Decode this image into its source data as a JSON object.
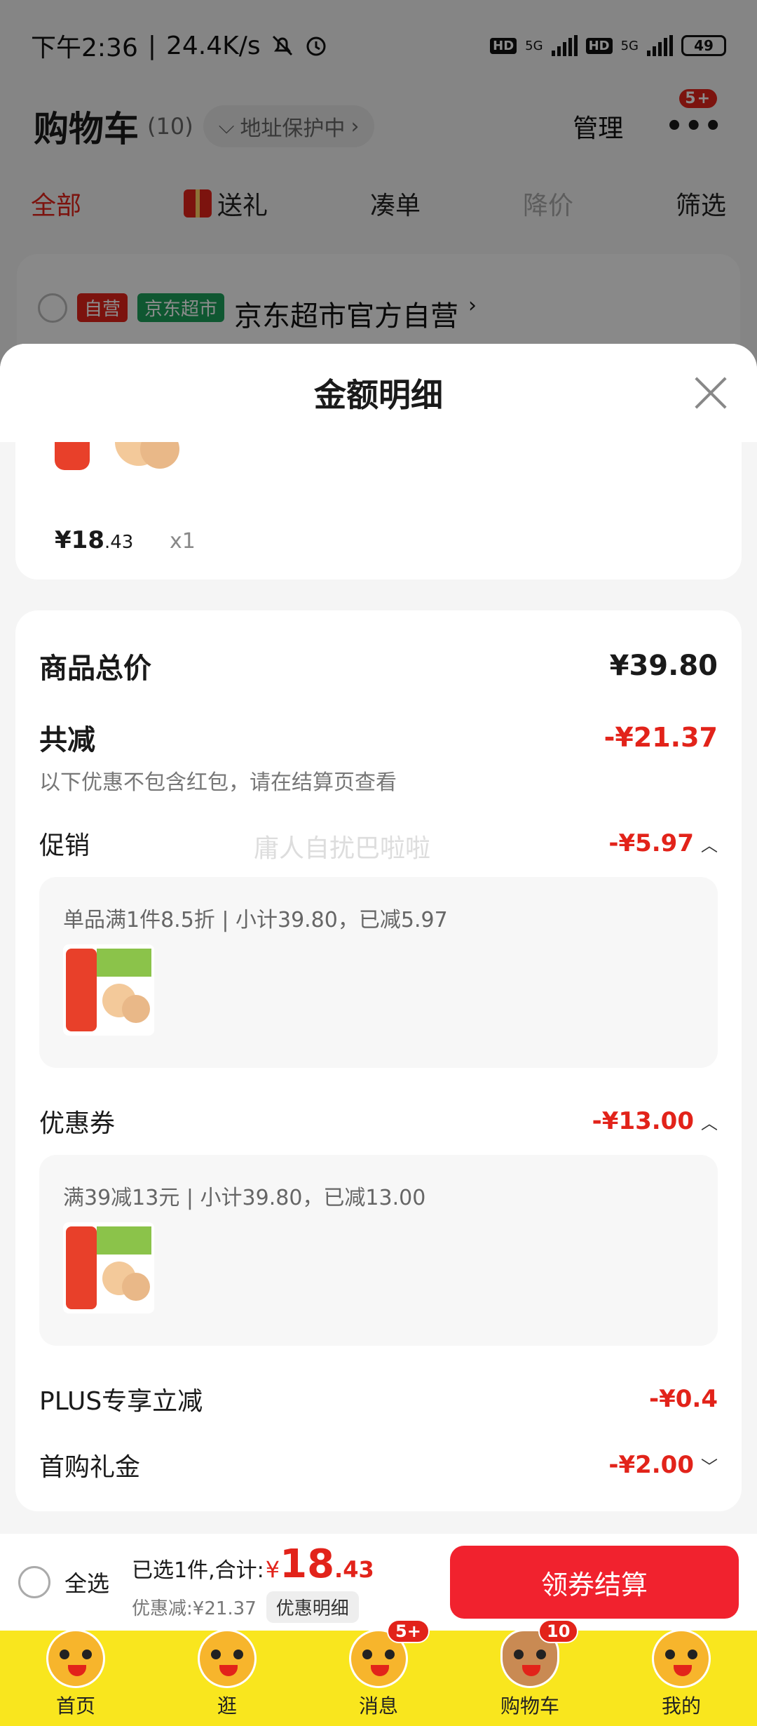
{
  "status_bar": {
    "time": "下午2:36",
    "speed": "24.4K/s",
    "battery": "49",
    "hd1": "HD",
    "net1": "5G",
    "hd2": "HD",
    "net2": "5G"
  },
  "header": {
    "title": "购物车",
    "count": "(10)",
    "address": "地址保护中",
    "manage": "管理",
    "more_badge": "5+"
  },
  "tabs": [
    {
      "label": "全部"
    },
    {
      "label": "送礼"
    },
    {
      "label": "凑单"
    },
    {
      "label": "降价"
    },
    {
      "label": "筛选"
    }
  ],
  "store": {
    "tag_self": "自营",
    "tag_market": "京东超市",
    "name": "京东超市官方自营"
  },
  "sheet": {
    "title": "金额明细",
    "product": {
      "price_int": "¥18",
      "price_dec": ".43",
      "qty": "x1"
    },
    "total_label": "商品总价",
    "total_value": "¥39.80",
    "discount_label": "共减",
    "discount_value": "-¥21.37",
    "note": "以下优惠不包含红包，请在结算页查看",
    "watermark": "庸人自扰巴啦啦",
    "promo": {
      "label": "促销",
      "value": "-¥5.97",
      "detail": "单品满1件8.5折 | 小计39.80，已减5.97"
    },
    "coupon": {
      "label": "优惠券",
      "value": "-¥13.00",
      "detail": "满39减13元 | 小计39.80，已减13.00"
    },
    "plus": {
      "label": "PLUS专享立减",
      "value": "-¥0.4"
    },
    "first": {
      "label": "首购礼金",
      "value": "-¥2.00"
    }
  },
  "checkout": {
    "select_all": "全选",
    "selected": "已选1件,合计:",
    "yen": "¥",
    "total_int": "18",
    "total_dec": ".43",
    "saved": "优惠减:¥21.37",
    "detail_btn": "优惠明细",
    "button": "领券结算"
  },
  "nav": [
    {
      "label": "首页"
    },
    {
      "label": "逛"
    },
    {
      "label": "消息",
      "badge": "5+"
    },
    {
      "label": "购物车",
      "badge": "10"
    },
    {
      "label": "我的"
    }
  ],
  "colors": {
    "accent_red": "#e2231a",
    "nav_yellow": "#f9e61e"
  }
}
